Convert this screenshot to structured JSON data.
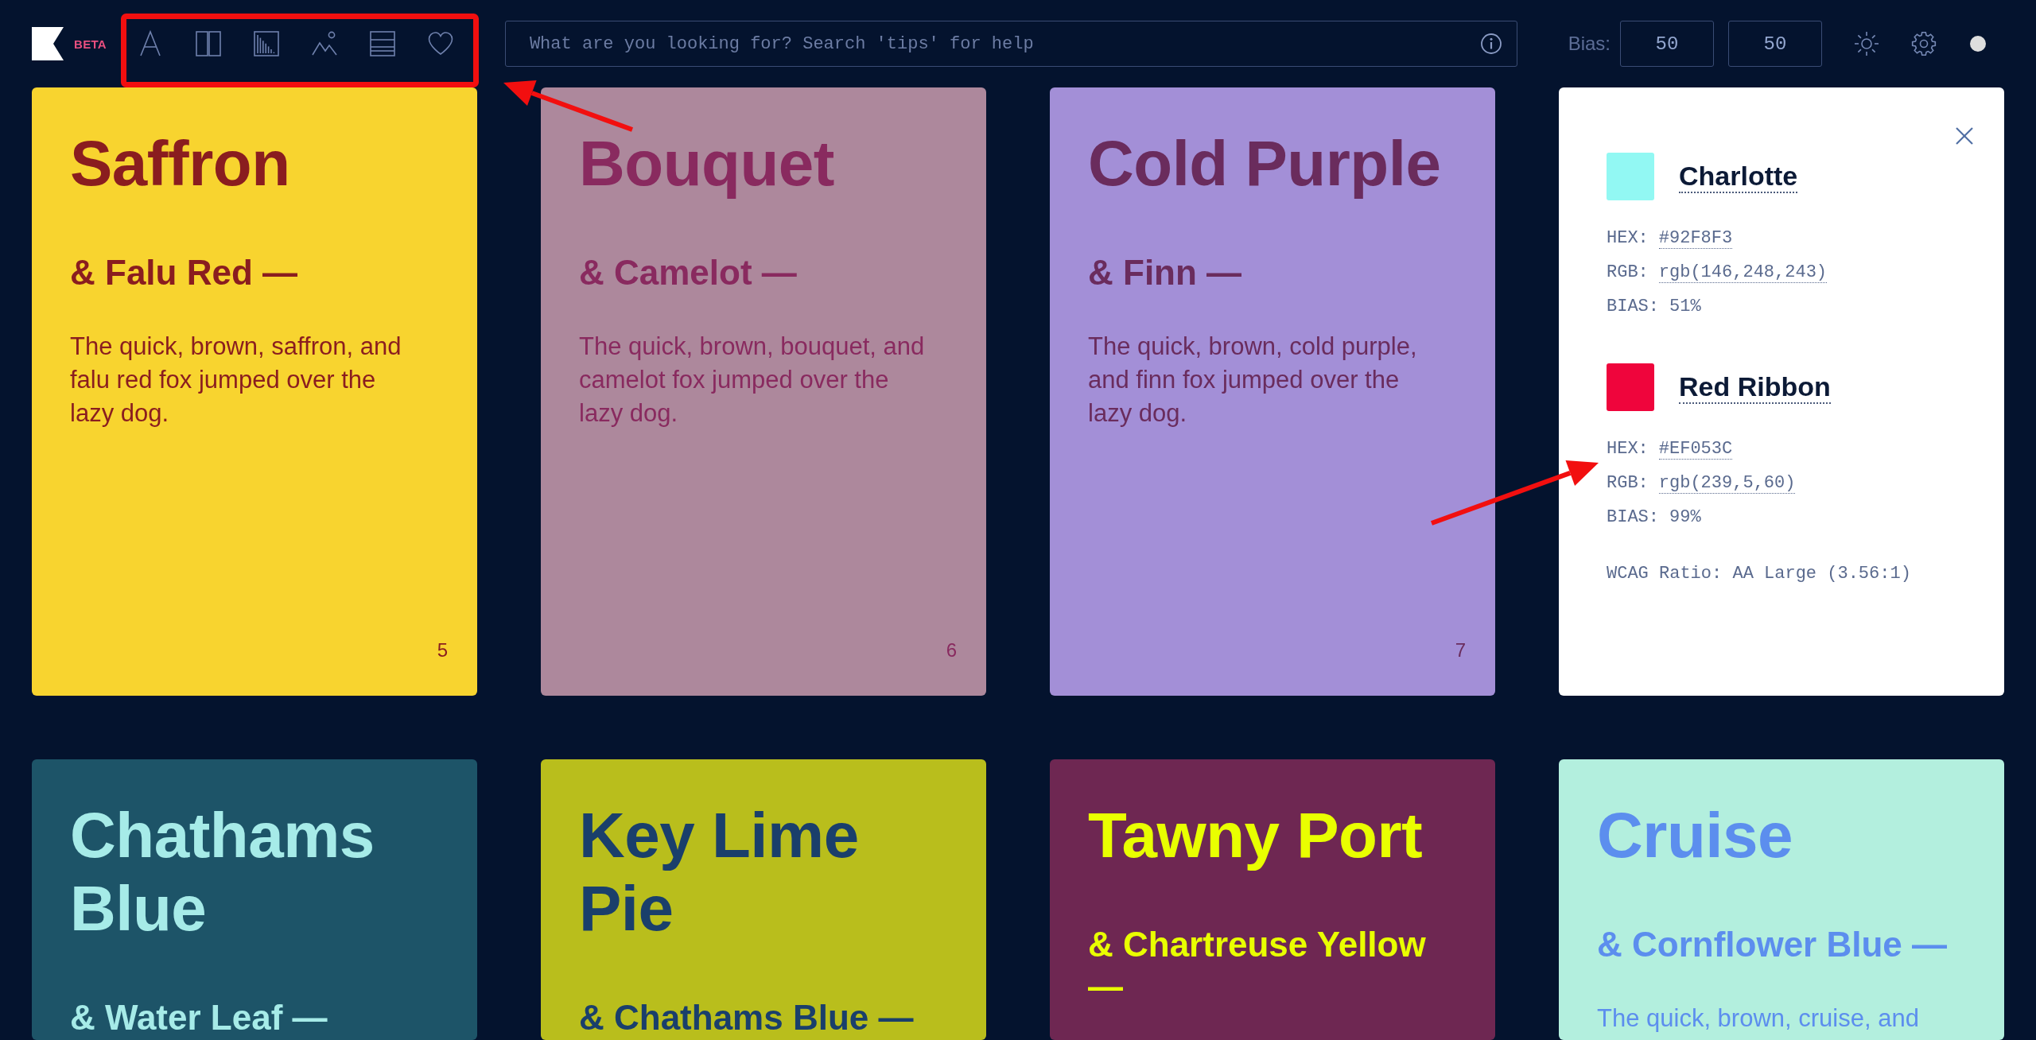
{
  "header": {
    "logo_badge": "BETA",
    "search": {
      "placeholder": "What are you looking for? Search 'tips' for help"
    },
    "bias": {
      "label": "Bias:",
      "values": [
        "50",
        "50"
      ]
    }
  },
  "cards": [
    {
      "kind": "pair",
      "title": "Saffron",
      "subtitle": "& Falu Red —",
      "body": "The quick, brown, saffron, and falu red fox jumped over the lazy dog.",
      "number": "5",
      "color": "#f8d42f",
      "accent": {
        "color": "#8a1d1f"
      }
    },
    {
      "kind": "pair",
      "title": "Bouquet",
      "subtitle": "& Camelot —",
      "body": "The quick, brown, bouquet, and camelot fox jumped over the lazy dog.",
      "number": "6",
      "color": "#ad889c",
      "accent": {
        "color": "#892a5f"
      }
    },
    {
      "kind": "pair",
      "title": "Cold Purple",
      "subtitle": "& Finn —",
      "body": "The quick, brown, cold purple, and finn fox jumped over the lazy dog.",
      "number": "7",
      "color": "#a38fd7",
      "accent": {
        "color": "#6a2c5d"
      }
    },
    {
      "kind": "detail",
      "swatches": [
        {
          "name": "Charlotte",
          "color": "#92f8f3",
          "hex_label": "HEX:",
          "hex": "#92F8F3",
          "rgb_label": "RGB:",
          "rgb": "rgb(146,248,243)",
          "bias_label": "BIAS:",
          "bias": "51%"
        },
        {
          "name": "Red Ribbon",
          "color": "#ef053c",
          "hex_label": "HEX:",
          "hex": "#EF053C",
          "rgb_label": "RGB:",
          "rgb": "rgb(239,5,60)",
          "bias_label": "BIAS:",
          "bias": "99%"
        }
      ],
      "wcag": "WCAG Ratio: AA Large (3.56:1)"
    },
    {
      "kind": "pair",
      "title": "Chathams Blue",
      "subtitle": "& Water Leaf —",
      "color": "#1d5468",
      "accent": {
        "color": "#a6ebe8"
      }
    },
    {
      "kind": "pair",
      "title": "Key Lime Pie",
      "subtitle": "& Chathams Blue —",
      "color": "#b9be1c",
      "accent": {
        "color": "#1a3f6b"
      }
    },
    {
      "kind": "pair",
      "title": "Tawny Port",
      "subtitle": "& Chartreuse Yellow —",
      "color": "#6e2752",
      "accent": {
        "color": "#e9ff00"
      }
    },
    {
      "kind": "pair",
      "title": "Cruise",
      "subtitle": "& Cornflower Blue —",
      "body": "The quick, brown, cruise, and",
      "color": "#b3efde",
      "accent": {
        "color": "#5c8eee"
      }
    }
  ]
}
